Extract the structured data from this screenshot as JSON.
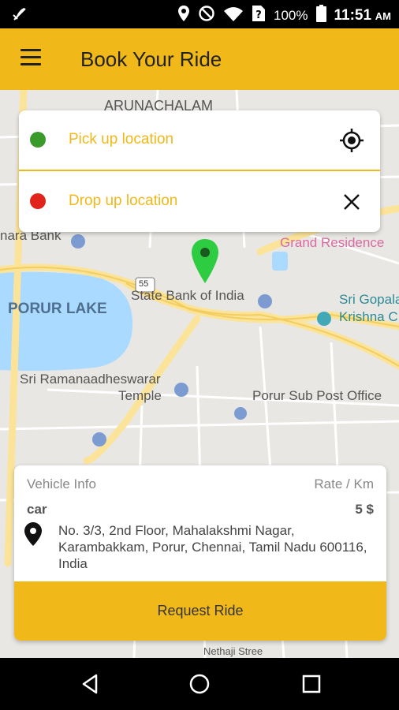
{
  "status_bar": {
    "battery": "100%",
    "time": "11:51",
    "ampm": "AM",
    "icons": [
      "no-sim-icon",
      "location-icon",
      "do-not-disturb-icon",
      "wifi-icon",
      "unknown-sim-icon",
      "battery-icon"
    ]
  },
  "app_bar": {
    "title": "Book Your Ride",
    "menu_icon": "hamburger-menu-icon"
  },
  "map_labels": {
    "arunachalam": "ARUNACHALAM",
    "canara_bank": "nara Bank",
    "grand_residence": "Grand Residence",
    "state_bank": "State Bank of India",
    "porur_lake": "PORUR LAKE",
    "sri_gopala": "Sri Gopala",
    "krishna": "Krishna C",
    "sri_ramanaadheswarar": "Sri Ramanaadheswarar",
    "temple": "Temple",
    "porur_post": "Porur Sub Post Office",
    "road_shield": "55",
    "nethaji": "Nethaji Stree"
  },
  "location_card": {
    "pickup_placeholder": "Pick up location",
    "drop_placeholder": "Drop up location",
    "pickup_dot_color": "#3a9a2a",
    "drop_dot_color": "#e0241b",
    "pickup_action_icon": "my-location-icon",
    "drop_action_icon": "close-icon"
  },
  "vehicle_info": {
    "vehicle_label": "Vehicle Info",
    "rate_label": "Rate / Km",
    "vehicle_value": "car",
    "rate_value": "5 $",
    "address": "No. 3/3, 2nd Floor, Mahalakshmi Nagar, Karambakkam, Porur, Chennai, Tamil Nadu 600116, India",
    "request_button": "Request Ride"
  },
  "nav_bar": {
    "icons": [
      "back-icon",
      "home-icon",
      "recents-icon"
    ]
  },
  "colors": {
    "accent": "#f1b81a",
    "marker": "#2ecc40"
  }
}
